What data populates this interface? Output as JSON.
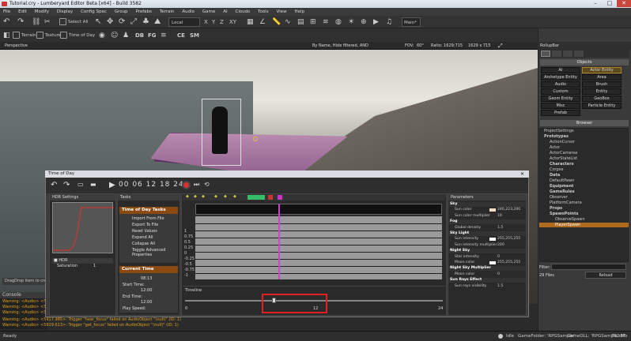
{
  "window": {
    "title": "Tutorial.cry - Lumberyard Editor Beta [x64] - Build 3582",
    "controls": [
      "–",
      "□",
      "✕"
    ]
  },
  "menu": [
    "File",
    "Edit",
    "Modify",
    "Display",
    "Config Spec",
    "Group",
    "Prefabs",
    "Terrain",
    "Audio",
    "Game",
    "AI",
    "Clouds",
    "Tools",
    "View",
    "Help"
  ],
  "toolbar": {
    "select_all": "Select All",
    "coord_system": "Local",
    "axes": [
      "X",
      "Y",
      "Z",
      "XY"
    ],
    "main_label": "Main*",
    "terrain": "Terrain",
    "texture": "Texture",
    "time_of_day": "Time of Day",
    "small_btns": [
      "DB",
      "FG",
      "CE",
      "SM"
    ]
  },
  "viewport": {
    "name": "Perspective",
    "filter_text": "By Name, Hide filtered, AND",
    "fov_label": "FOV:",
    "fov_value": "60°",
    "ratio_label": "Ratio: 1629:715",
    "resolution": "1629 x 715"
  },
  "dragdrop": "DragDrop item to create",
  "console": {
    "title": "Console",
    "lines": [
      "Warning: <Audio> <5917.98...",
      "Warning: <Audio> <5917.98...",
      "Warning: <Audio> <5917.98...",
      "Warning: <Audio> <5917.985>: Trigger \"hear_focus\" failed on AudioObject \"(null)\" (ID: 1)",
      "Warning: <Audio> <5919.613>: Trigger \"get_focus\" failed on AudioObject \"(null)\" (ID: 1)"
    ]
  },
  "status": {
    "ready": "Ready",
    "idle": "Idle",
    "game_folder": "GameFolder: 'RPGSample'",
    "game_dll": "GameDLL: 'RPGSample.dll'",
    "memory": "762 Mb"
  },
  "rollup": {
    "title": "RollupBar",
    "objects_title": "Objects",
    "object_buttons": [
      "AI",
      "Actor Entity",
      "Archetype Entity",
      "Area",
      "Audio",
      "Brush",
      "Custom",
      "Entity",
      "Geom Entity",
      "GeoBox",
      "Misc",
      "Particle Entity",
      "Prefab"
    ],
    "browser_title": "Browser",
    "tree": [
      "ProjectSettings",
      "Prototypes",
      "ActionCursor",
      "Actor",
      "ActorCameras",
      "ActorStateList",
      "Characters",
      "Corpse",
      "Data",
      "DefaultPawn",
      "Equipment",
      "GameRules",
      "Observer",
      "PlatformCamera",
      "Props",
      "SpawnPoints",
      "ObserveSpawn",
      "PlayerSpawn"
    ],
    "filter_label": "Filter:",
    "files_count": "29 Files",
    "reload": "Reload"
  },
  "tod": {
    "title": "Time of Day",
    "time_display": "00 06 12 18 24",
    "hdr_title": "HDR Settings",
    "hdr_row": "HDR",
    "hdr_sub": "Saturation",
    "hdr_sub_value": "1",
    "tasks_title": "Tasks",
    "tod_tasks_head": "Time of Day Tasks",
    "tasks": [
      "Import From File",
      "Export To File",
      "Reset Values",
      "Expand All",
      "Collapse All",
      "Toggle Advanced Properties"
    ],
    "current_time_head": "Current Time",
    "current_time": "08:13",
    "start_time_label": "Start Time:",
    "start_time": "12:00",
    "end_time_label": "End Time:",
    "end_time": "12:00",
    "play_speed_label": "Play Speed:",
    "graph_y_labels": [
      "1",
      "0.75",
      "0.5",
      "0.25",
      "0",
      "-0.25",
      "-0.5",
      "-0.75",
      "-1"
    ],
    "timeline_title": "Timeline",
    "timeline_min": "0",
    "timeline_mid": "12",
    "timeline_max": "24",
    "params_title": "Parameters",
    "params": [
      {
        "name": "Sky",
        "value": "",
        "hdr": true
      },
      {
        "name": "Sun color",
        "value": "246,223,200",
        "hdr": false,
        "color": "#f6dfc8"
      },
      {
        "name": "Sun color multiplier",
        "value": "10",
        "hdr": false
      },
      {
        "name": "Fog",
        "value": "",
        "hdr": true
      },
      {
        "name": "Global density",
        "value": "1.5",
        "hdr": false
      },
      {
        "name": "Sky Light",
        "value": "",
        "hdr": true
      },
      {
        "name": "Sun intensity",
        "value": "255,255,255",
        "hdr": false,
        "color": "#ffffff"
      },
      {
        "name": "Sun intensity multiplier",
        "value": "200",
        "hdr": false
      },
      {
        "name": "Night Sky",
        "value": "",
        "hdr": true
      },
      {
        "name": "Star intensity",
        "value": "0",
        "hdr": false
      },
      {
        "name": "Moon color",
        "value": "255,255,255",
        "hdr": false,
        "color": "#ffffff"
      },
      {
        "name": "Night Sky Multiplier",
        "value": "",
        "hdr": true
      },
      {
        "name": "Moon color",
        "value": "0",
        "hdr": false
      },
      {
        "name": "Sun Rays Effect",
        "value": "",
        "hdr": true
      },
      {
        "name": "Sun rays visibility",
        "value": "1.5",
        "hdr": false
      }
    ]
  },
  "colors": {
    "accent_orange": "#b06a1e",
    "timeline_highlight": "#e02020",
    "graph_marker": "#cc44cc"
  }
}
